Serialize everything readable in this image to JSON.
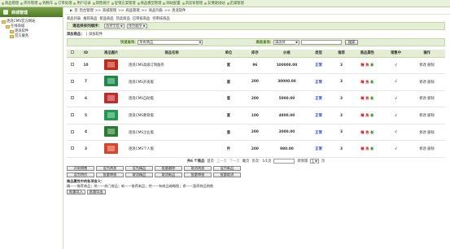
{
  "topbar": [
    "商品管理",
    "库存管理",
    "购物车",
    "订单处理",
    "用户记录",
    "销售统计",
    "促销方案管理",
    "商品模型管理",
    "网站配置",
    "浏览背管理",
    "友情链接站",
    "店铺管理"
  ],
  "sidebar": {
    "title": "商城管理",
    "tree": [
      {
        "label": "逐浪CMS官方网站",
        "level": 0
      },
      {
        "label": "在线商城",
        "level": 1
      },
      {
        "label": "逐浪软件",
        "level": 2
      },
      {
        "label": "官方服务",
        "level": 2
      }
    ]
  },
  "breadcrumb": {
    "prefix": "您",
    "items": [
      "后台管理",
      "商城管理",
      "商品管理",
      "商品列表",
      "逐浪软件"
    ]
  },
  "subnav": [
    "商品列表",
    "推荐商品",
    "新品商品",
    "热卖商品",
    "已审核商品",
    "待审核商品"
  ],
  "filter": {
    "label": "请选择排列顺序：",
    "sort1": "选择字段",
    "sort2": "排列顺序"
  },
  "add": {
    "label": "添加商品：",
    "link": "添加软件"
  },
  "search": {
    "quick_label": "快速查询：",
    "quick_value": "所有商品",
    "adv_label": "高级查询：",
    "adv_value": "请选择",
    "button": "搜索"
  },
  "table": {
    "headers": [
      "ID",
      "商品图片",
      "商品名称",
      "单位",
      "库存",
      "价格",
      "类型",
      "推荐",
      "商品属性",
      "销售中",
      "操作"
    ],
    "rows": [
      {
        "id": "10",
        "name": "逐浪CMS高级订制服务",
        "unit": "套",
        "stock": "96",
        "price": "100000.00",
        "type": "正常",
        "rec": "3",
        "attrs": [
          "精",
          "热",
          "新"
        ],
        "on": "√",
        "ops": "修改 删除",
        "color": "#c42a1a"
      },
      {
        "id": "7",
        "name": "逐浪CMS开发版",
        "unit": "套",
        "stock": "200",
        "price": "30000.00",
        "type": "正常",
        "rec": "3",
        "attrs": [
          "精",
          "热",
          "新"
        ],
        "on": "√",
        "ops": "修改 删除",
        "color": "#1d8a4a"
      },
      {
        "id": "6",
        "name": "逐浪CMS自助版",
        "unit": "套",
        "stock": "200",
        "price": "5000.00",
        "type": "正常",
        "rec": "3",
        "attrs": [
          "精",
          "热",
          "新"
        ],
        "on": "√",
        "ops": "修改 删除",
        "color": "#c22c2c"
      },
      {
        "id": "5",
        "name": "逐浪CMS教育版",
        "unit": "套",
        "stock": "100",
        "price": "4800.00",
        "type": "正常",
        "rec": "3",
        "attrs": [
          "精",
          "热",
          "新"
        ],
        "on": "√",
        "ops": "修改 删除",
        "color": "#1f9a50"
      },
      {
        "id": "4",
        "name": "逐浪CMS企业版",
        "unit": "套",
        "stock": "200",
        "price": "3000.00",
        "type": "正常",
        "rec": "3",
        "attrs": [
          "精",
          "热",
          "新"
        ],
        "on": "√",
        "ops": "修改 删除",
        "color": "#2a7a30"
      },
      {
        "id": "3",
        "name": "逐浪CMS个人版",
        "unit": "件",
        "stock": "200",
        "price": "980.00",
        "type": "正常",
        "rec": "3",
        "attrs": [
          "精",
          "热",
          "新"
        ],
        "on": "√",
        "ops": "修改 删除",
        "color": "#d4472a"
      }
    ]
  },
  "pager": {
    "total": "共6 个商品",
    "first": "首页",
    "prev": "上一页",
    "next": "下一页",
    "last": "尾页",
    "page": "页次：1/1页",
    "goto": "转到第",
    "unit": "页"
  },
  "actions_row1": [
    "开始销售",
    "设为热卖",
    "设为精品",
    "批量删除",
    "取消热卖",
    "设为新品",
    "设为特价",
    "批量审核",
    "取消精品",
    "取消新品",
    "批量审核",
    "批量取消"
  ],
  "legend": {
    "title": "商品属性中的各项含义：",
    "items": "精——推荐商品；热——热门商品；新——推荐新品；特——有商品缩略图；停——暂停商品销售"
  },
  "actions_row2": [
    "批量导入",
    "批量导出"
  ]
}
